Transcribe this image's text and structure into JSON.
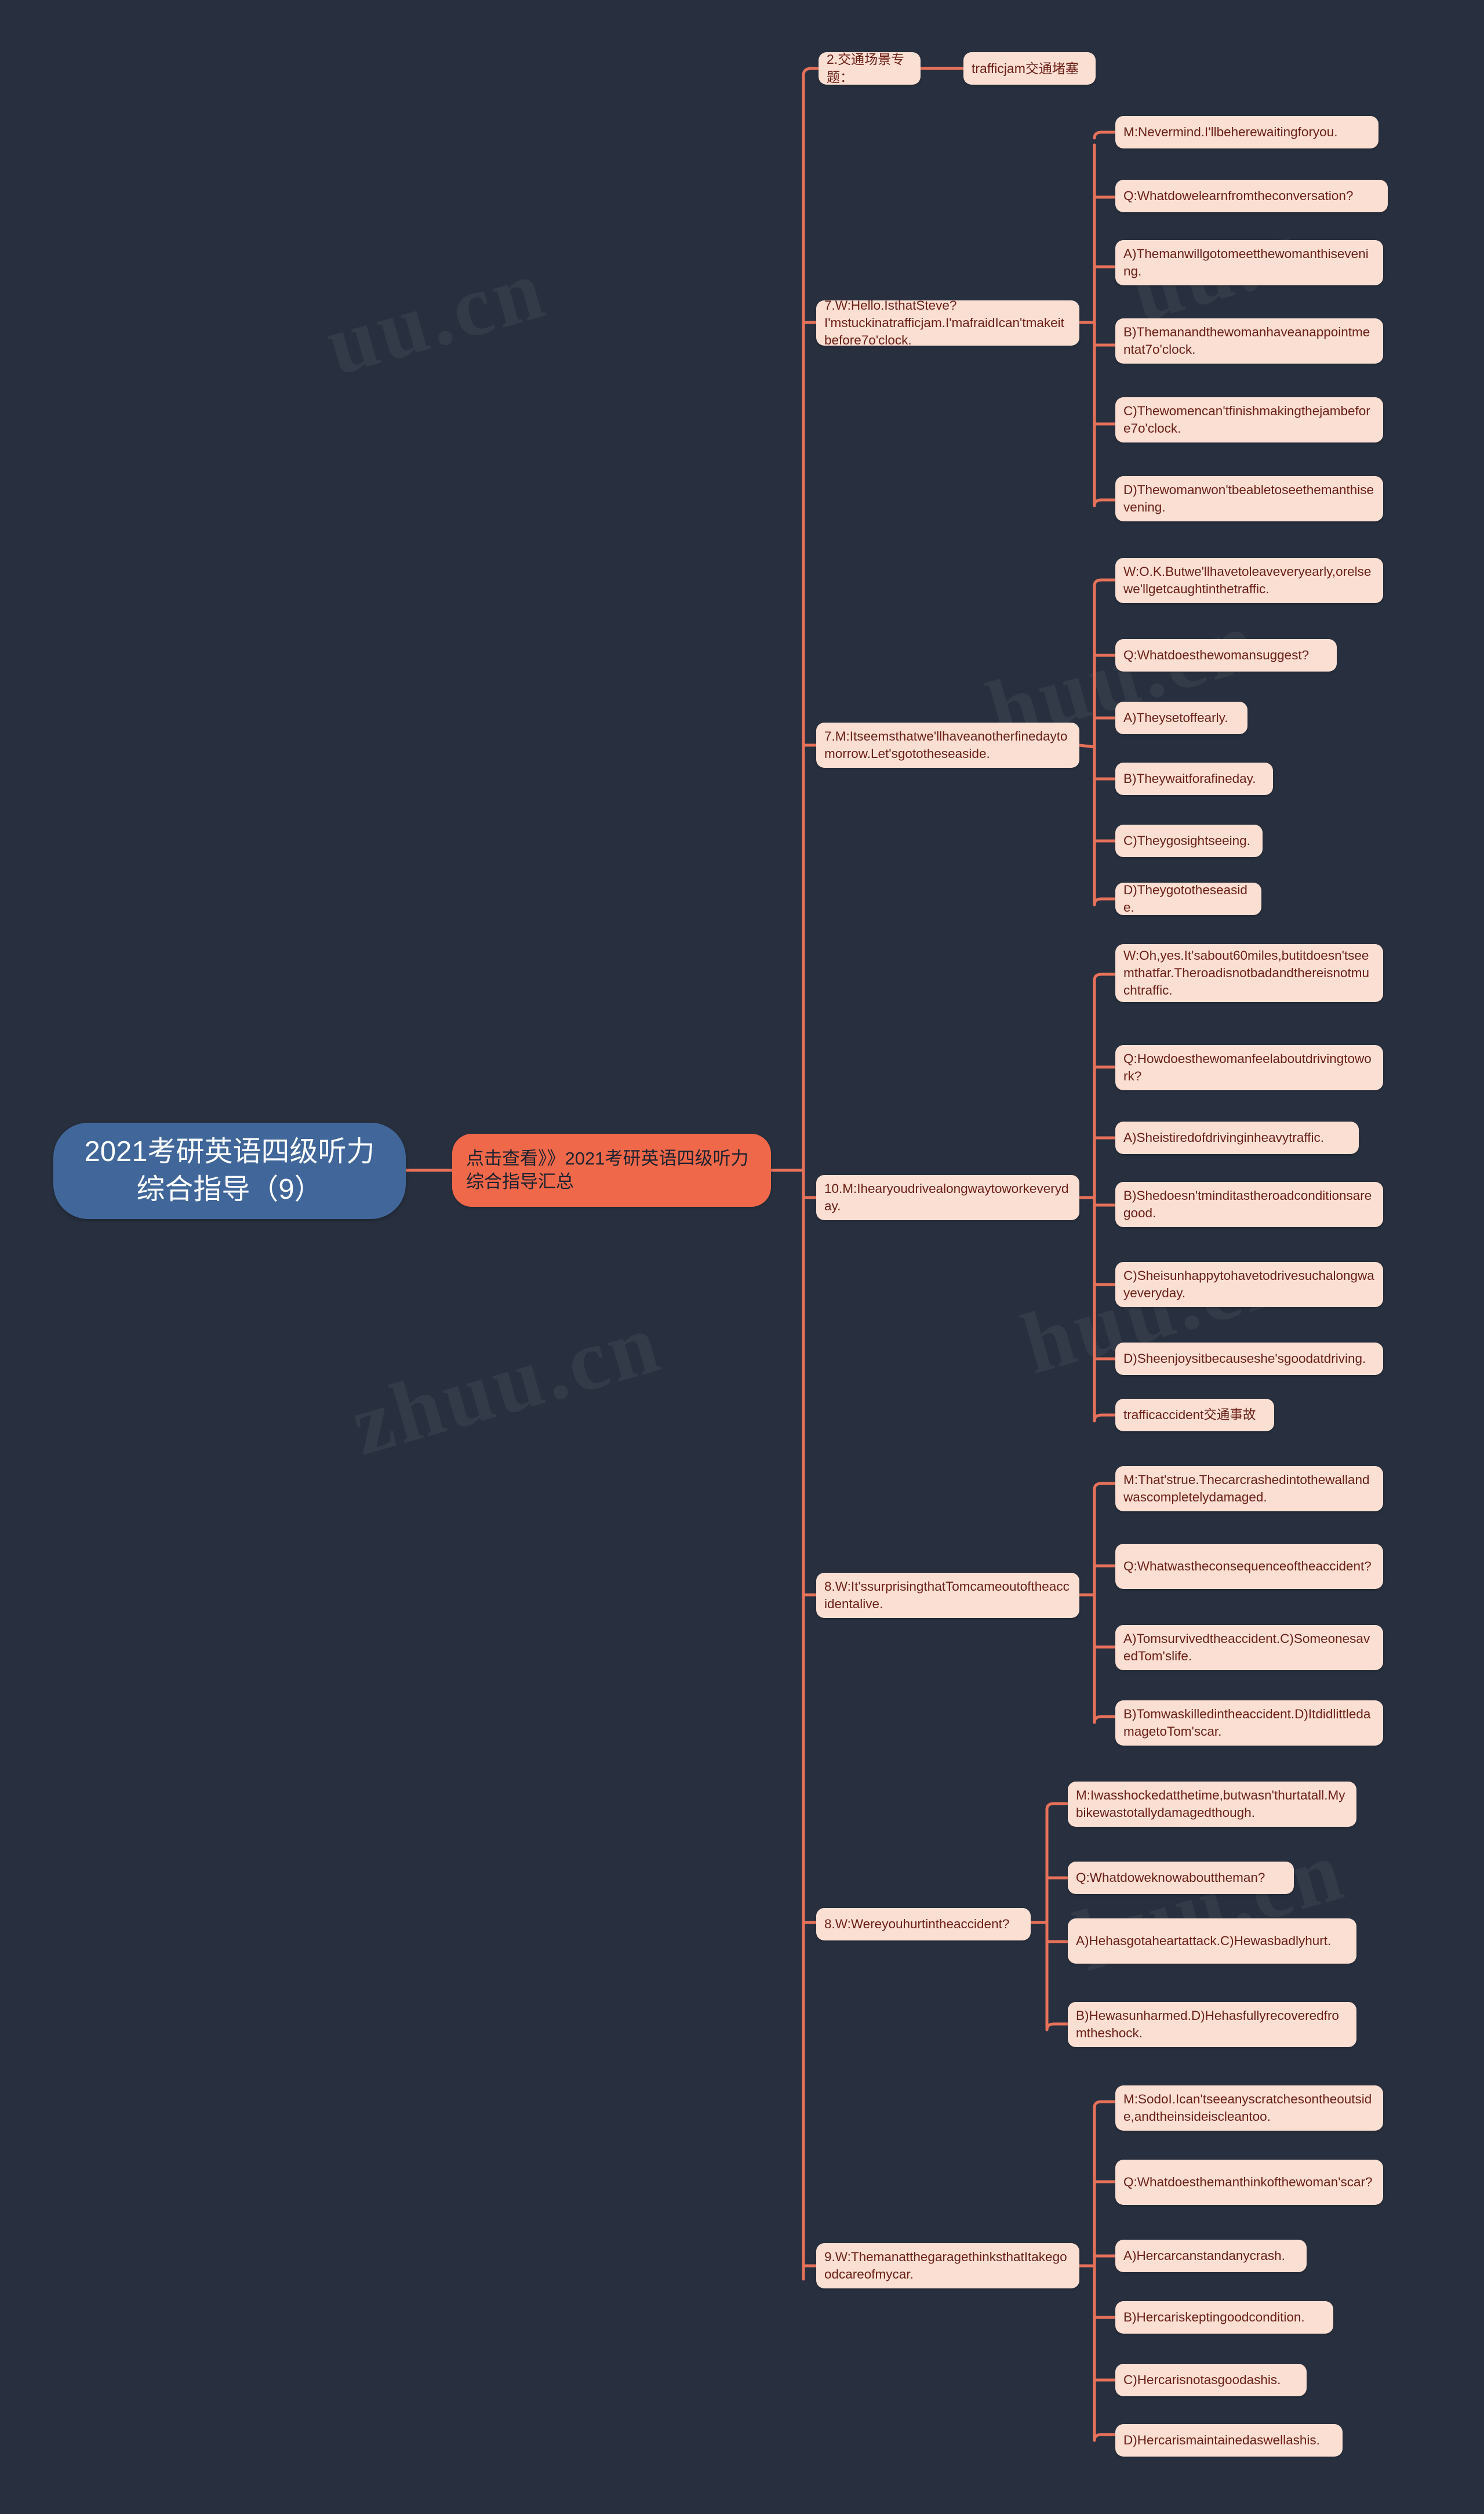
{
  "mindmap": {
    "title": "2021考研英语四级听力综合指导（9）",
    "background_color": "#28303f",
    "root_color": "#41679a",
    "accent_color": "#f0684a",
    "leaf_color": "#fbdfd3",
    "line_color": "#e8715a",
    "root": {
      "label": "2021考研英语四级听力综合指导（9）"
    },
    "accent": {
      "label": "点击查看》》2021考研英语四级听力综合指导汇总"
    },
    "topic": {
      "label": "2.交通场景专题："
    },
    "topic_child": {
      "label": "trafficjam交通堵塞"
    },
    "groups": [
      {
        "id": "g1",
        "parent": "7.W:Hello.IsthatSteve?I'mstuckinatrafficjam.I'mafraidIcan'tmakeitbefore7o'clock.",
        "children": [
          "M:Nevermind.I'llbeherewaitingforyou.",
          "Q:Whatdowelearnfromtheconversation?",
          "A)Themanwillgotomeetthewomanthisevening.",
          "B)Themanandthewomanhaveanappointmentat7o'clock.",
          "C)Thewomencan'tfinishmakingthejambefore7o'clock.",
          "D)Thewomanwon'tbeabletoseethemanthisevening."
        ]
      },
      {
        "id": "g2",
        "parent": "7.M:Itseemsthatwe'llhaveanotherfinedaytomorrow.Let'sgototheseaside.",
        "children": [
          "W:O.K.Butwe'llhavetoleaveveryearly,orelsewe'llgetcaughtinthetraffic.",
          "Q:Whatdoesthewomansuggest?",
          "A)Theysetoffearly.",
          "B)Theywaitforafineday.",
          "C)Theygosightseeing.",
          "D)Theygototheseaside."
        ]
      },
      {
        "id": "g3",
        "parent": "10.M:Ihearyoudrivealongwaytoworkeveryday.",
        "children": [
          "W:Oh,yes.It'sabout60miles,butitdoesn'tseemthatfar.Theroadisnotbadandthereisnotmuchtraffic.",
          "Q:Howdoesthewomanfeelaboutdrivingtowork?",
          "A)Sheistiredofdrivinginheavytraffic.",
          "B)Shedoesn'tminditastheroadconditionsaregood.",
          "C)Sheisunhappytohavetodrivesuchalongwayeveryday.",
          "D)Sheenjoysitbecauseshe'sgoodatdriving.",
          "trafficaccident交通事故"
        ]
      },
      {
        "id": "g4",
        "parent": "8.W:It'ssurprisingthatTomcameoutoftheaccidentalive.",
        "children": [
          "M:That'strue.Thecarcrashedintothewallandwascompletelydamaged.",
          "Q:Whatwastheconsequenceoftheaccident?",
          "A)Tomsurvivedtheaccident.C)SomeonesavedTom'slife.",
          "B)Tomwaskilledintheaccident.D)ItdidlittledamagetoTom'scar."
        ]
      },
      {
        "id": "g5",
        "parent": "8.W:Wereyouhurtintheaccident?",
        "children": [
          "M:Iwasshockedatthetime,butwasn'thurtatall.Mybikewastotallydamagedthough.",
          "Q:Whatdoweknowabouttheman?",
          "A)Hehasgotaheartattack.C)Hewasbadlyhurt.",
          "B)Hewasunharmed.D)Hehasfullyrecoveredfromtheshock."
        ]
      },
      {
        "id": "g6",
        "parent": "9.W:ThemanatthegaragethinksthatItakegoodcareofmycar.",
        "children": [
          "M:SodoI.Ican'tseeanyscratchesontheoutside,andtheinsideiscleantoo.",
          "Q:Whatdoesthemanthinkofthewoman'scar?",
          "A)Hercarcanstandanycrash.",
          "B)Hercariskeptingoodcondition.",
          "C)Hercarisnotasgoodashis.",
          "D)Hercarismaintainedaswellashis."
        ]
      }
    ]
  }
}
